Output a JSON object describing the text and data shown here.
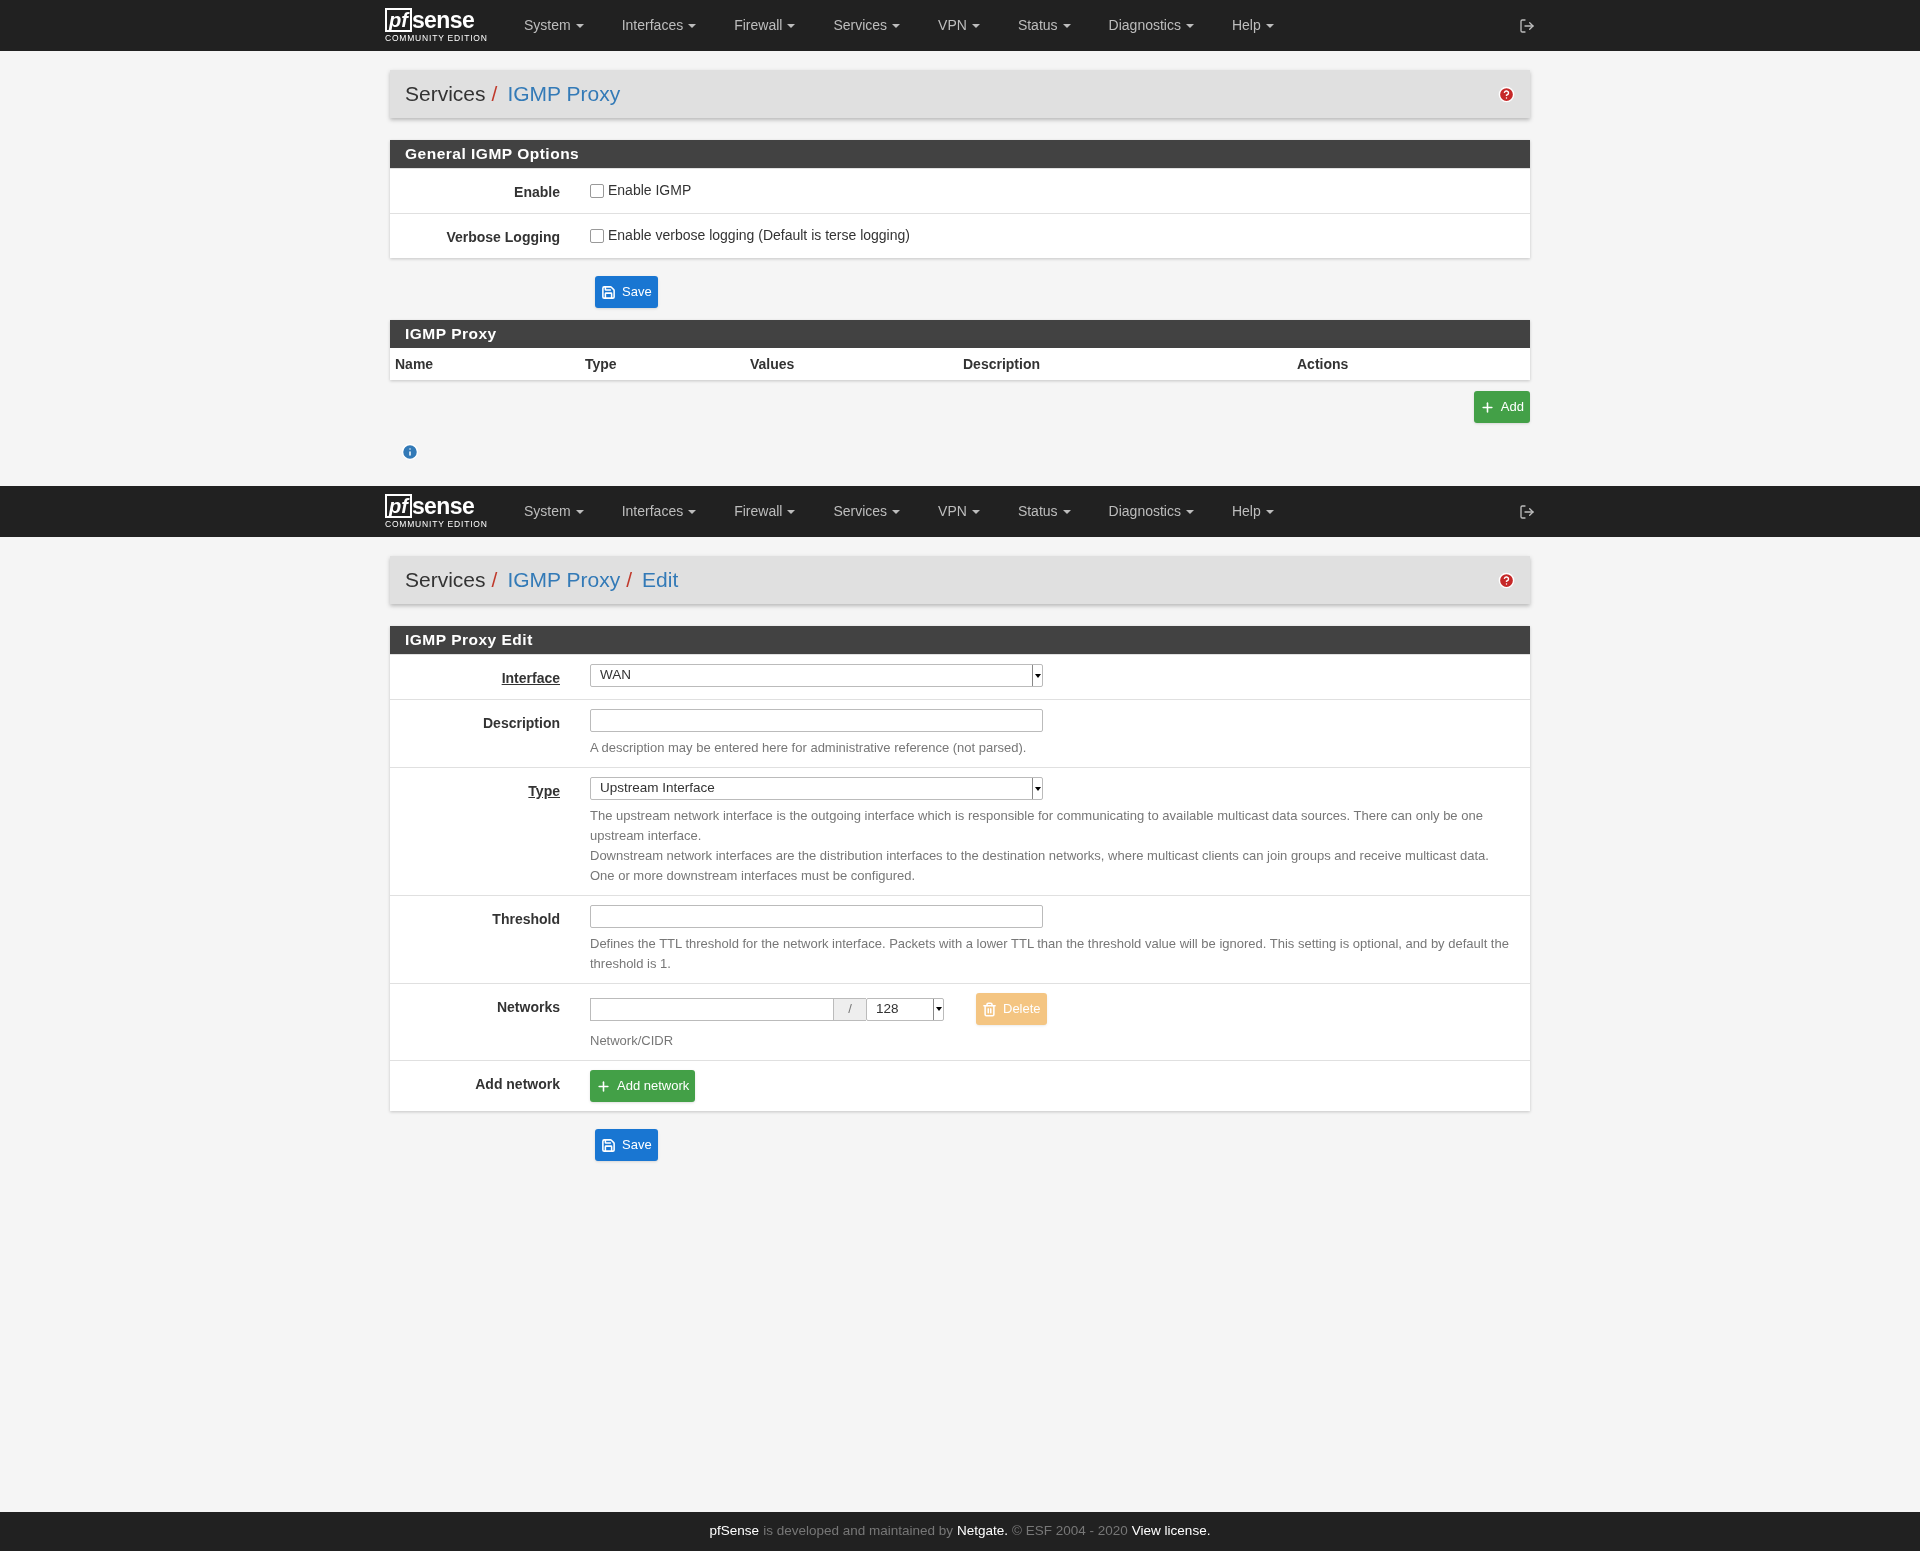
{
  "pages": [
    {
      "navbar": {
        "logo": {
          "mark": "pf",
          "word": "sense",
          "edition": "COMMUNITY EDITION"
        },
        "menu": [
          {
            "label": "System"
          },
          {
            "label": "Interfaces"
          },
          {
            "label": "Firewall"
          },
          {
            "label": "Services"
          },
          {
            "label": "VPN"
          },
          {
            "label": "Status"
          },
          {
            "label": "Diagnostics"
          },
          {
            "label": "Help"
          }
        ]
      },
      "breadcrumb": [
        {
          "kind": "text",
          "label": "Services"
        },
        {
          "kind": "separator",
          "label": "/"
        },
        {
          "kind": "link",
          "label": "IGMP Proxy"
        }
      ],
      "blocks": [
        {
          "kind": "form_panel",
          "title": "General IGMP Options",
          "rows": [
            {
              "kind": "checkbox",
              "label": "Enable",
              "required": false,
              "checked": false,
              "text": "Enable IGMP"
            },
            {
              "kind": "checkbox",
              "label": "Verbose Logging",
              "required": false,
              "checked": false,
              "text": "Enable verbose logging (Default is terse logging)"
            }
          ]
        },
        {
          "kind": "save",
          "label": "Save"
        },
        {
          "kind": "table_panel",
          "title": "IGMP Proxy",
          "columns": [
            "Name",
            "Type",
            "Values",
            "Description",
            "Actions"
          ]
        },
        {
          "kind": "add",
          "label": "Add"
        },
        {
          "kind": "info"
        }
      ]
    },
    {
      "navbar": {
        "logo": {
          "mark": "pf",
          "word": "sense",
          "edition": "COMMUNITY EDITION"
        },
        "menu": [
          {
            "label": "System"
          },
          {
            "label": "Interfaces"
          },
          {
            "label": "Firewall"
          },
          {
            "label": "Services"
          },
          {
            "label": "VPN"
          },
          {
            "label": "Status"
          },
          {
            "label": "Diagnostics"
          },
          {
            "label": "Help"
          }
        ]
      },
      "breadcrumb": [
        {
          "kind": "text",
          "label": "Services"
        },
        {
          "kind": "separator",
          "label": "/"
        },
        {
          "kind": "link",
          "label": "IGMP Proxy"
        },
        {
          "kind": "separator",
          "label": "/"
        },
        {
          "kind": "link",
          "label": "Edit"
        }
      ],
      "blocks": [
        {
          "kind": "form_panel",
          "title": "IGMP Proxy Edit",
          "rows": [
            {
              "kind": "select",
              "label": "Interface",
              "required": true,
              "value": "WAN"
            },
            {
              "kind": "input",
              "label": "Description",
              "required": false,
              "help": [
                "A description may be entered here for administrative reference (not parsed)."
              ]
            },
            {
              "kind": "select",
              "label": "Type",
              "required": true,
              "value": "Upstream Interface",
              "help": [
                "The upstream network interface is the outgoing interface which is responsible for communicating to available multicast data sources. There can only be one upstream interface.",
                "Downstream network interfaces are the distribution interfaces to the destination networks, where multicast clients can join groups and receive multicast data. One or more downstream interfaces must be configured."
              ]
            },
            {
              "kind": "input",
              "label": "Threshold",
              "required": false,
              "help": [
                "Defines the TTL threshold for the network interface. Packets with a lower TTL than the threshold value will be ignored. This setting is optional, and by default the threshold is 1."
              ]
            },
            {
              "kind": "network",
              "label": "Networks",
              "required": false,
              "separator": "/",
              "cidr": "128",
              "help": [
                "Network/CIDR"
              ],
              "button": {
                "label": "Delete",
                "disabled": true
              }
            },
            {
              "kind": "button",
              "label": "Add network",
              "required": false,
              "button": {
                "label": "Add network"
              }
            }
          ]
        },
        {
          "kind": "save",
          "label": "Save"
        }
      ]
    }
  ],
  "footer": {
    "brand": "pfSense",
    "text": "is developed and maintained by",
    "company": "Netgate.",
    "copyright": "© ESF 2004 - 2020",
    "license": "View license."
  }
}
